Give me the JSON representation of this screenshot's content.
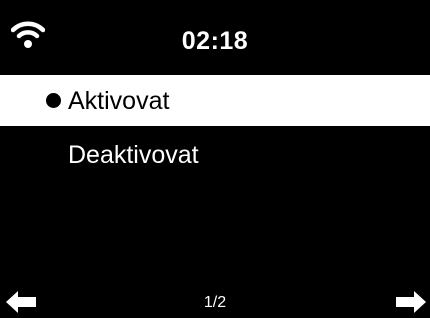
{
  "status_bar": {
    "time": "02:18",
    "wifi_icon": "wifi-signal-icon"
  },
  "menu": {
    "items": [
      {
        "label": "Aktivovat",
        "selected": true
      },
      {
        "label": "Deaktivovat",
        "selected": false
      }
    ]
  },
  "footer": {
    "page_indicator": "1/2",
    "back_icon": "arrow-left-icon",
    "next_icon": "arrow-right-icon"
  },
  "colors": {
    "background": "#000000",
    "foreground": "#ffffff",
    "selection_background": "#ffffff",
    "selection_text": "#000000"
  }
}
